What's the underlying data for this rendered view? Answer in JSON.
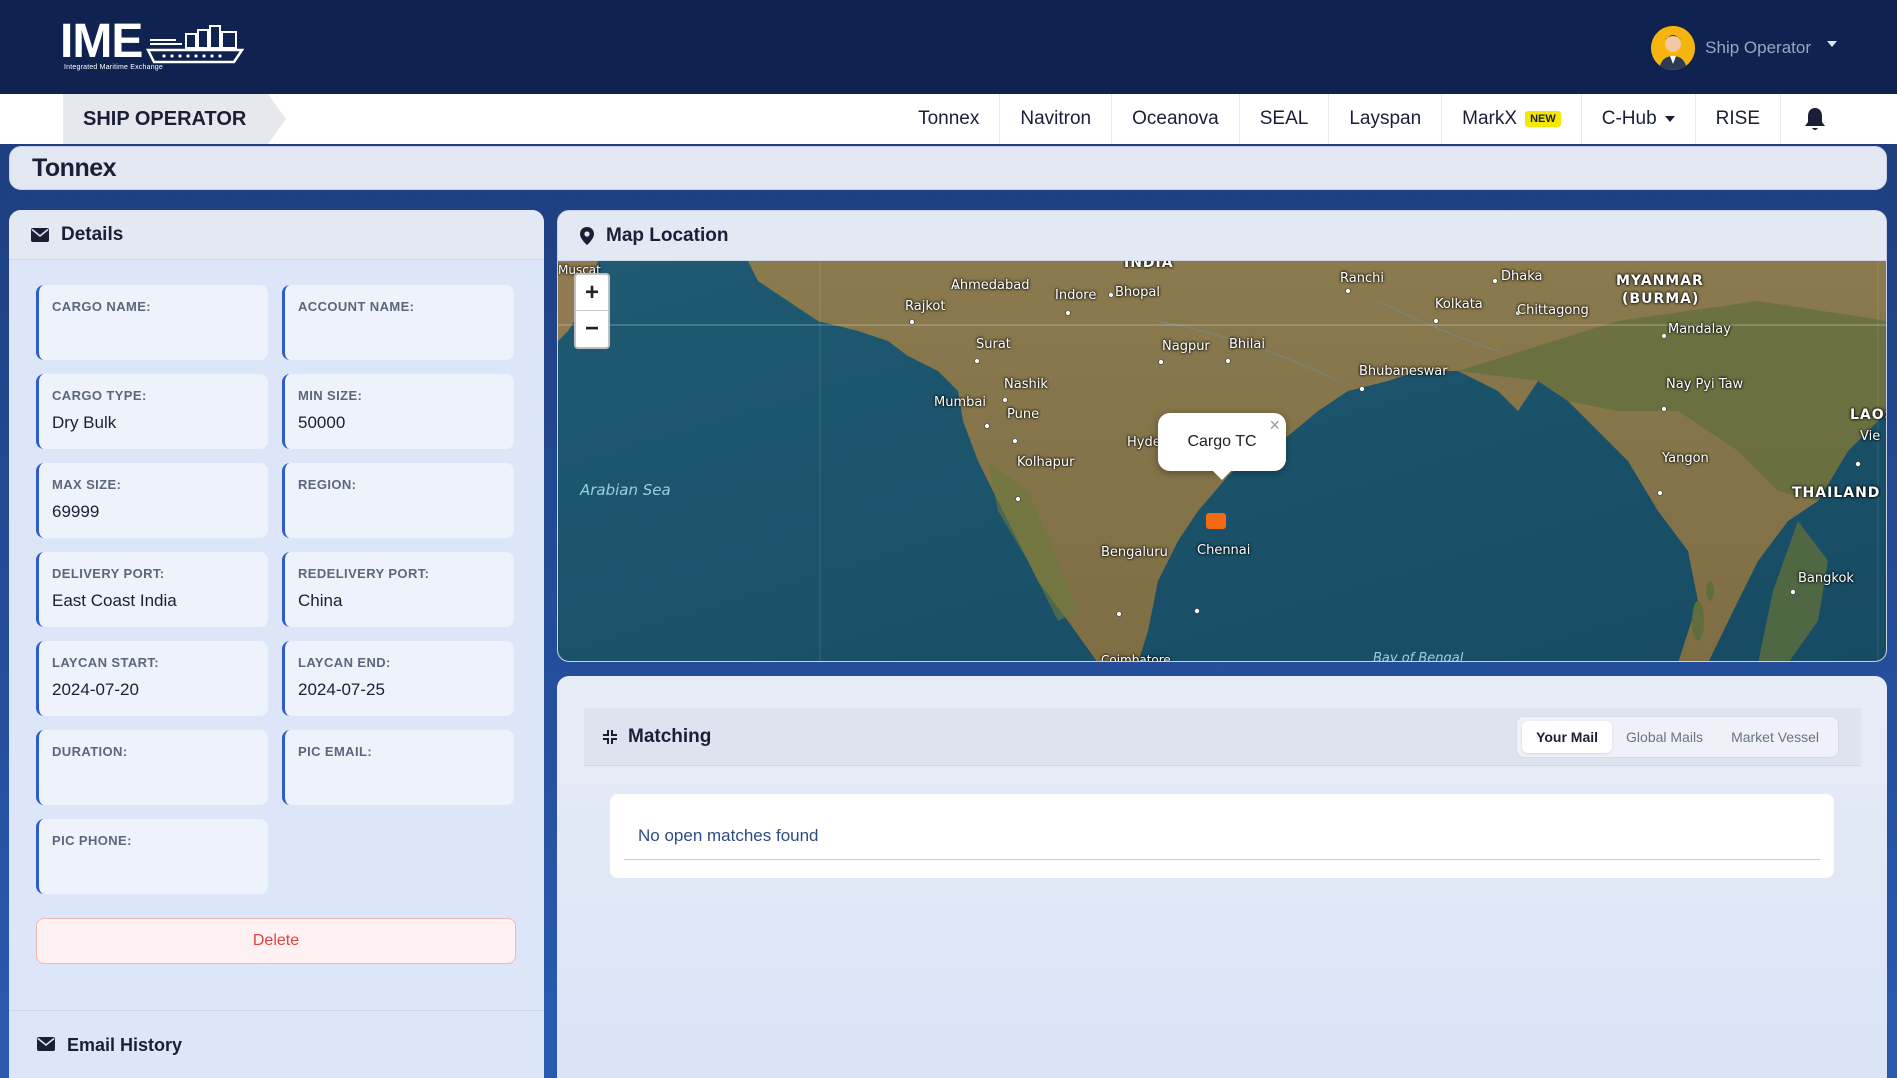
{
  "header": {
    "logo_text": "IME",
    "logo_subtitle": "Integrated Maritime Exchange",
    "user_name": "Ship Operator"
  },
  "nav": {
    "role": "SHIP OPERATOR",
    "items": [
      {
        "label": "Tonnex"
      },
      {
        "label": "Navitron"
      },
      {
        "label": "Oceanova"
      },
      {
        "label": "SEAL"
      },
      {
        "label": "Layspan"
      },
      {
        "label": "MarkX",
        "badge": "NEW"
      },
      {
        "label": "C-Hub"
      },
      {
        "label": "RISE"
      }
    ]
  },
  "page_title": "Tonnex",
  "details": {
    "title": "Details",
    "fields": [
      {
        "label": "CARGO NAME:",
        "value": ""
      },
      {
        "label": "ACCOUNT NAME:",
        "value": ""
      },
      {
        "label": "CARGO TYPE:",
        "value": "Dry Bulk"
      },
      {
        "label": "MIN SIZE:",
        "value": "50000"
      },
      {
        "label": "MAX SIZE:",
        "value": "69999"
      },
      {
        "label": "REGION:",
        "value": ""
      },
      {
        "label": "DELIVERY PORT:",
        "value": "East Coast India"
      },
      {
        "label": "REDELIVERY PORT:",
        "value": "China"
      },
      {
        "label": "LAYCAN START:",
        "value": "2024-07-20"
      },
      {
        "label": "LAYCAN END:",
        "value": "2024-07-25"
      },
      {
        "label": "DURATION:",
        "value": ""
      },
      {
        "label": "PIC EMAIL:",
        "value": ""
      },
      {
        "label": "PIC PHONE:",
        "value": ""
      }
    ],
    "delete_label": "Delete",
    "email_history": "Email History"
  },
  "map": {
    "title": "Map Location",
    "zoom_in": "+",
    "zoom_out": "−",
    "popup_label": "Cargo TC",
    "popup_close": "×",
    "places": [
      "INDIA",
      "Muscat",
      "Ahmedabad",
      "Indore",
      "Bhopal",
      "Rajkot",
      "Ranchi",
      "Dhaka",
      "MYANMAR",
      "(BURMA)",
      "Kolkata",
      "Chittagong",
      "Mandalay",
      "Surat",
      "Nagpur",
      "Bhilai",
      "Nashik",
      "Bhubaneswar",
      "Mumbai",
      "Pune",
      "Nay Pyi Taw",
      "LAOS",
      "Vie",
      "Hyde",
      "Kolhapur",
      "Yangon",
      "Arabian Sea",
      "THAILAND",
      "Bengaluru",
      "Chennai",
      "Bangkok",
      "Coimbatore",
      "Bay of Bengal"
    ]
  },
  "matching": {
    "title": "Matching",
    "tabs": [
      {
        "label": "Your Mail",
        "active": true
      },
      {
        "label": "Global Mails",
        "active": false
      },
      {
        "label": "Market Vessel",
        "active": false
      }
    ],
    "empty_text": "No open matches found"
  },
  "colors": {
    "header_bg": "#0f2250",
    "accent": "#2e5dc5",
    "delete": "#e0443e",
    "marker": "#f26a14"
  }
}
